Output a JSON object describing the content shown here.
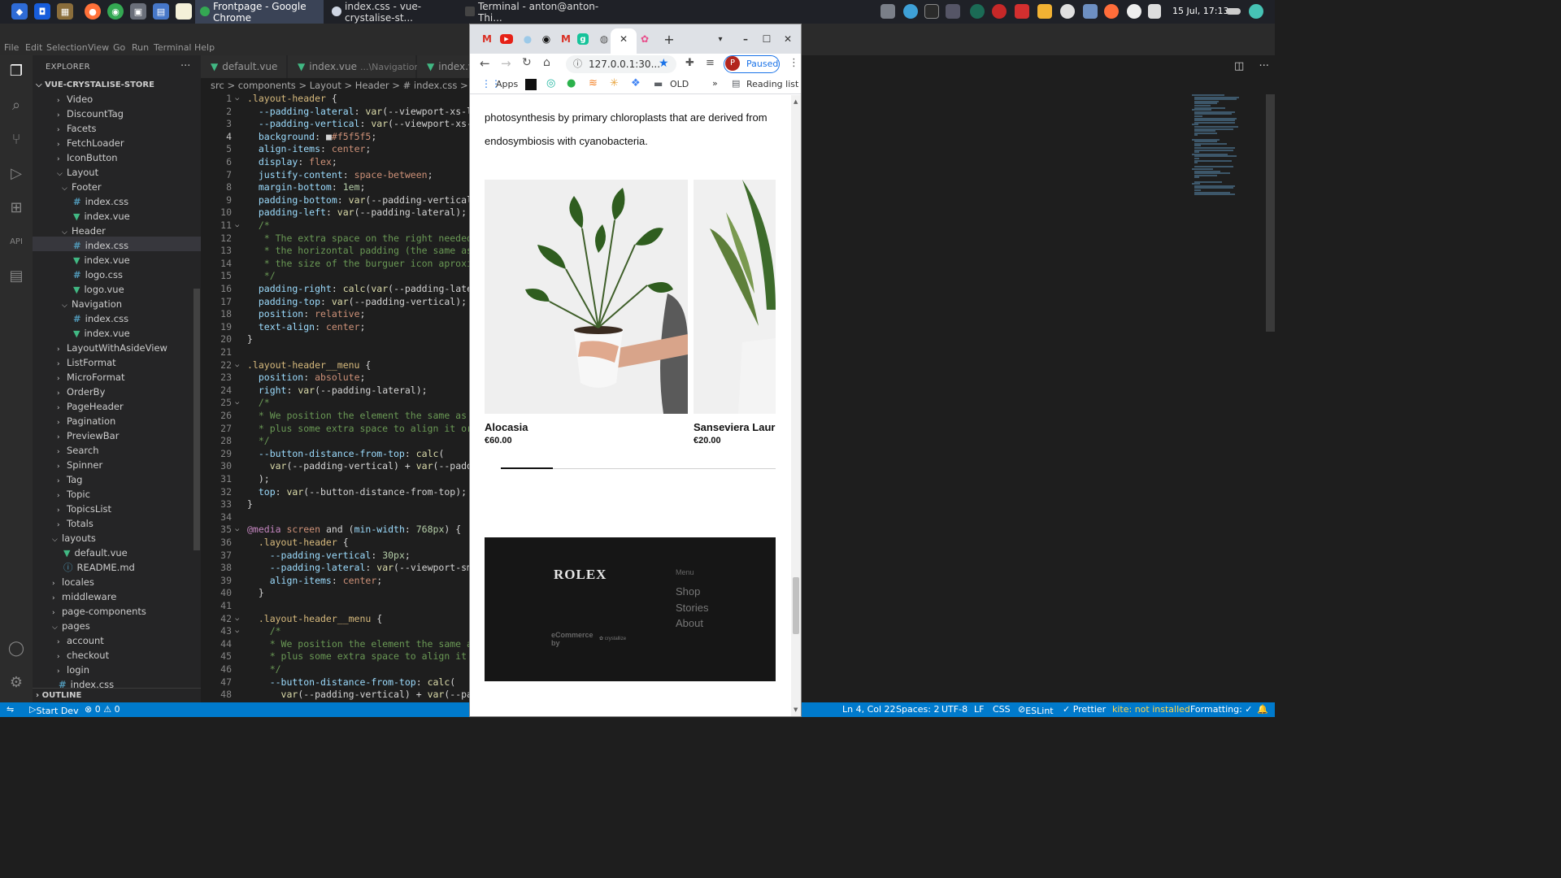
{
  "taskbar": {
    "tasks": [
      {
        "label": "Frontpage - Google Chrome",
        "active": true
      },
      {
        "label": "index.css - vue-crystalise-st...",
        "active": false
      },
      {
        "label": "Terminal - anton@anton-Thi...",
        "active": false
      }
    ],
    "clock": "15 Jul, 17:13"
  },
  "vscode": {
    "menu": [
      "File",
      "Edit",
      "Selection",
      "View",
      "Go",
      "Run",
      "Terminal",
      "Help"
    ],
    "explorer_title": "EXPLORER",
    "project": "VUE-CRYSTALISE-STORE",
    "tree": [
      {
        "label": "Video",
        "type": "folder",
        "indent": 0
      },
      {
        "label": "DiscountTag",
        "type": "folder",
        "indent": 0
      },
      {
        "label": "Facets",
        "type": "folder",
        "indent": 0
      },
      {
        "label": "FetchLoader",
        "type": "folder",
        "indent": 0
      },
      {
        "label": "IconButton",
        "type": "folder",
        "indent": 0
      },
      {
        "label": "Layout",
        "type": "folder-open",
        "indent": 0
      },
      {
        "label": "Footer",
        "type": "folder-open",
        "indent": 1
      },
      {
        "label": "index.css",
        "type": "css",
        "indent": 2
      },
      {
        "label": "index.vue",
        "type": "vue",
        "indent": 2
      },
      {
        "label": "Header",
        "type": "folder-open",
        "indent": 1
      },
      {
        "label": "index.css",
        "type": "css",
        "indent": 2
      },
      {
        "label": "index.vue",
        "type": "vue",
        "indent": 2
      },
      {
        "label": "logo.css",
        "type": "css",
        "indent": 2
      },
      {
        "label": "logo.vue",
        "type": "vue",
        "indent": 2
      },
      {
        "label": "Navigation",
        "type": "folder-open",
        "indent": 1
      },
      {
        "label": "index.css",
        "type": "css",
        "indent": 2
      },
      {
        "label": "index.vue",
        "type": "vue",
        "indent": 2
      },
      {
        "label": "LayoutWithAsideView",
        "type": "folder",
        "indent": 0
      },
      {
        "label": "ListFormat",
        "type": "folder",
        "indent": 0
      },
      {
        "label": "MicroFormat",
        "type": "folder",
        "indent": 0
      },
      {
        "label": "OrderBy",
        "type": "folder",
        "indent": 0
      },
      {
        "label": "PageHeader",
        "type": "folder",
        "indent": 0
      },
      {
        "label": "Pagination",
        "type": "folder",
        "indent": 0
      },
      {
        "label": "PreviewBar",
        "type": "folder",
        "indent": 0
      },
      {
        "label": "Search",
        "type": "folder",
        "indent": 0
      },
      {
        "label": "Spinner",
        "type": "folder",
        "indent": 0
      },
      {
        "label": "Tag",
        "type": "folder",
        "indent": 0
      },
      {
        "label": "Topic",
        "type": "folder",
        "indent": 0
      },
      {
        "label": "TopicsList",
        "type": "folder",
        "indent": 0
      },
      {
        "label": "Totals",
        "type": "folder",
        "indent": 0
      },
      {
        "label": "layouts",
        "type": "folder-open",
        "indent": -1
      },
      {
        "label": "default.vue",
        "type": "vue",
        "indent": 0
      },
      {
        "label": "README.md",
        "type": "md",
        "indent": 0
      },
      {
        "label": "locales",
        "type": "folder",
        "indent": -1
      },
      {
        "label": "middleware",
        "type": "folder",
        "indent": -1
      },
      {
        "label": "page-components",
        "type": "folder",
        "indent": -1
      },
      {
        "label": "pages",
        "type": "folder-open",
        "indent": -1
      },
      {
        "label": "account",
        "type": "folder",
        "indent": 0
      },
      {
        "label": "checkout",
        "type": "folder",
        "indent": 0
      },
      {
        "label": "login",
        "type": "folder",
        "indent": 0
      },
      {
        "label": "index.css",
        "type": "css",
        "indent": -1
      }
    ],
    "outline_label": "OUTLINE",
    "tabs": [
      {
        "label": "default.vue",
        "sub": ""
      },
      {
        "label": "index.vue",
        "sub": "...\\Navigation"
      },
      {
        "label": "index.v",
        "sub": ""
      }
    ],
    "breadcrumb": "src > components > Layout > Header > # index.css > ⬡ .layou",
    "code": [
      [
        [
          ".layout-header ",
          "k"
        ],
        [
          "{",
          "b"
        ]
      ],
      [
        [
          "  --padding-lateral",
          "p"
        ],
        [
          ": ",
          "b"
        ],
        [
          "var",
          "f"
        ],
        [
          "(--viewport-xs-l",
          "b"
        ]
      ],
      [
        [
          "  --padding-vertical",
          "p"
        ],
        [
          ": ",
          "b"
        ],
        [
          "var",
          "f"
        ],
        [
          "(--viewport-xs-",
          "b"
        ]
      ],
      [
        [
          "  background",
          "p"
        ],
        [
          ": ",
          "b"
        ],
        [
          "■",
          "b"
        ],
        [
          "#f5f5f5",
          "v"
        ],
        [
          ";",
          "b"
        ]
      ],
      [
        [
          "  align-items",
          "p"
        ],
        [
          ": ",
          "b"
        ],
        [
          "center",
          "v"
        ],
        [
          ";",
          "b"
        ]
      ],
      [
        [
          "  display",
          "p"
        ],
        [
          ": ",
          "b"
        ],
        [
          "flex",
          "v"
        ],
        [
          ";",
          "b"
        ]
      ],
      [
        [
          "  justify-content",
          "p"
        ],
        [
          ": ",
          "b"
        ],
        [
          "space-between",
          "v"
        ],
        [
          ";",
          "b"
        ]
      ],
      [
        [
          "  margin-bottom",
          "p"
        ],
        [
          ": ",
          "b"
        ],
        [
          "1em",
          "n"
        ],
        [
          ";",
          "b"
        ]
      ],
      [
        [
          "  padding-bottom",
          "p"
        ],
        [
          ": ",
          "b"
        ],
        [
          "var",
          "f"
        ],
        [
          "(--padding-vertical",
          "b"
        ]
      ],
      [
        [
          "  padding-left",
          "p"
        ],
        [
          ": ",
          "b"
        ],
        [
          "var",
          "f"
        ],
        [
          "(--padding-lateral);",
          "b"
        ]
      ],
      [
        [
          "  /*",
          "c"
        ]
      ],
      [
        [
          "   * The extra space on the right needed",
          "c"
        ]
      ],
      [
        [
          "   * the horizontal padding (the same as",
          "c"
        ]
      ],
      [
        [
          "   * the size of the burguer icon aproxi",
          "c"
        ]
      ],
      [
        [
          "   */",
          "c"
        ]
      ],
      [
        [
          "  padding-right",
          "p"
        ],
        [
          ": ",
          "b"
        ],
        [
          "calc",
          "f"
        ],
        [
          "(",
          "b"
        ],
        [
          "var",
          "f"
        ],
        [
          "(--padding-late",
          "b"
        ]
      ],
      [
        [
          "  padding-top",
          "p"
        ],
        [
          ": ",
          "b"
        ],
        [
          "var",
          "f"
        ],
        [
          "(--padding-vertical);",
          "b"
        ]
      ],
      [
        [
          "  position",
          "p"
        ],
        [
          ": ",
          "b"
        ],
        [
          "relative",
          "v"
        ],
        [
          ";",
          "b"
        ]
      ],
      [
        [
          "  text-align",
          "p"
        ],
        [
          ": ",
          "b"
        ],
        [
          "center",
          "v"
        ],
        [
          ";",
          "b"
        ]
      ],
      [
        [
          "}",
          "b"
        ]
      ],
      [
        [
          "",
          "b"
        ]
      ],
      [
        [
          ".layout-header__menu ",
          "k"
        ],
        [
          "{",
          "b"
        ]
      ],
      [
        [
          "  position",
          "p"
        ],
        [
          ": ",
          "b"
        ],
        [
          "absolute",
          "v"
        ],
        [
          ";",
          "b"
        ]
      ],
      [
        [
          "  right",
          "p"
        ],
        [
          ": ",
          "b"
        ],
        [
          "var",
          "f"
        ],
        [
          "(--padding-lateral);",
          "b"
        ]
      ],
      [
        [
          "  /*",
          "c"
        ]
      ],
      [
        [
          "  * We position the element the same as",
          "c"
        ]
      ],
      [
        [
          "  * plus some extra space to align it or",
          "c"
        ]
      ],
      [
        [
          "  */",
          "c"
        ]
      ],
      [
        [
          "  --button-distance-from-top",
          "p"
        ],
        [
          ": ",
          "b"
        ],
        [
          "calc",
          "f"
        ],
        [
          "(",
          "b"
        ]
      ],
      [
        [
          "    ",
          "b"
        ],
        [
          "var",
          "f"
        ],
        [
          "(--padding-vertical) + ",
          "b"
        ],
        [
          "var",
          "f"
        ],
        [
          "(--padd",
          "b"
        ]
      ],
      [
        [
          "  );",
          "b"
        ]
      ],
      [
        [
          "  top",
          "p"
        ],
        [
          ": ",
          "b"
        ],
        [
          "var",
          "f"
        ],
        [
          "(--button-distance-from-top);",
          "b"
        ]
      ],
      [
        [
          "}",
          "b"
        ]
      ],
      [
        [
          "",
          "b"
        ]
      ],
      [
        [
          "@media",
          "at"
        ],
        [
          " screen ",
          "v"
        ],
        [
          "and",
          "b"
        ],
        [
          " (",
          "b"
        ],
        [
          "min-width",
          "p"
        ],
        [
          ": ",
          "b"
        ],
        [
          "768px",
          "n"
        ],
        [
          ") {",
          "b"
        ]
      ],
      [
        [
          "  .layout-header ",
          "k"
        ],
        [
          "{",
          "b"
        ]
      ],
      [
        [
          "    --padding-vertical",
          "p"
        ],
        [
          ": ",
          "b"
        ],
        [
          "30px",
          "n"
        ],
        [
          ";",
          "b"
        ]
      ],
      [
        [
          "    --padding-lateral",
          "p"
        ],
        [
          ": ",
          "b"
        ],
        [
          "var",
          "f"
        ],
        [
          "(--viewport-sm",
          "b"
        ]
      ],
      [
        [
          "    align-items",
          "p"
        ],
        [
          ": ",
          "b"
        ],
        [
          "center",
          "v"
        ],
        [
          ";",
          "b"
        ]
      ],
      [
        [
          "  }",
          "b"
        ]
      ],
      [
        [
          "",
          "b"
        ]
      ],
      [
        [
          "  .layout-header__menu ",
          "k"
        ],
        [
          "{",
          "b"
        ]
      ],
      [
        [
          "    /*",
          "c"
        ]
      ],
      [
        [
          "    * We position the element the same a",
          "c"
        ]
      ],
      [
        [
          "    * plus some extra space to align it",
          "c"
        ]
      ],
      [
        [
          "    */",
          "c"
        ]
      ],
      [
        [
          "    --button-distance-from-top",
          "p"
        ],
        [
          ": ",
          "b"
        ],
        [
          "calc",
          "f"
        ],
        [
          "(",
          "b"
        ]
      ],
      [
        [
          "      ",
          "b"
        ],
        [
          "var",
          "f"
        ],
        [
          "(--padding-vertical) + ",
          "b"
        ],
        [
          "var",
          "f"
        ],
        [
          "(--pa",
          "b"
        ]
      ]
    ],
    "fold_lines": [
      1,
      11,
      22,
      25,
      35,
      42,
      43
    ],
    "status": {
      "remote": "",
      "start": "Start Dev",
      "problems": "⊗ 0 ⚠ 0",
      "position": "Ln 4, Col 22",
      "spaces": "Spaces: 2",
      "encoding": "UTF-8",
      "eol": "LF",
      "lang": "CSS",
      "eslint": "ESLint",
      "prettier": "✓ Prettier",
      "kite": "kite: not installed",
      "formatting": "Formatting: ✓"
    }
  },
  "chrome": {
    "url": "127.0.0.1:30...",
    "profile_initial": "P",
    "paused": "Paused",
    "bookmarks": {
      "apps": "Apps",
      "folder": "OLD",
      "more": "»",
      "reading": "Reading list"
    },
    "page": {
      "paragraph_lines": [
        "photosynthesis by primary chloroplasts that are derived from",
        "endosymbiosis with cyanobacteria."
      ],
      "products": [
        {
          "name": "Alocasia",
          "price": "€60.00"
        },
        {
          "name": "Sanseviera Laur",
          "price": "€20.00"
        }
      ],
      "carousel_progress": 0.19,
      "footer": {
        "brand": "ROLEX",
        "menu_title": "Menu",
        "menu_items": [
          "Shop",
          "Stories",
          "About"
        ],
        "credit": "eCommerce by",
        "credit_logo": "crystallize"
      }
    }
  }
}
